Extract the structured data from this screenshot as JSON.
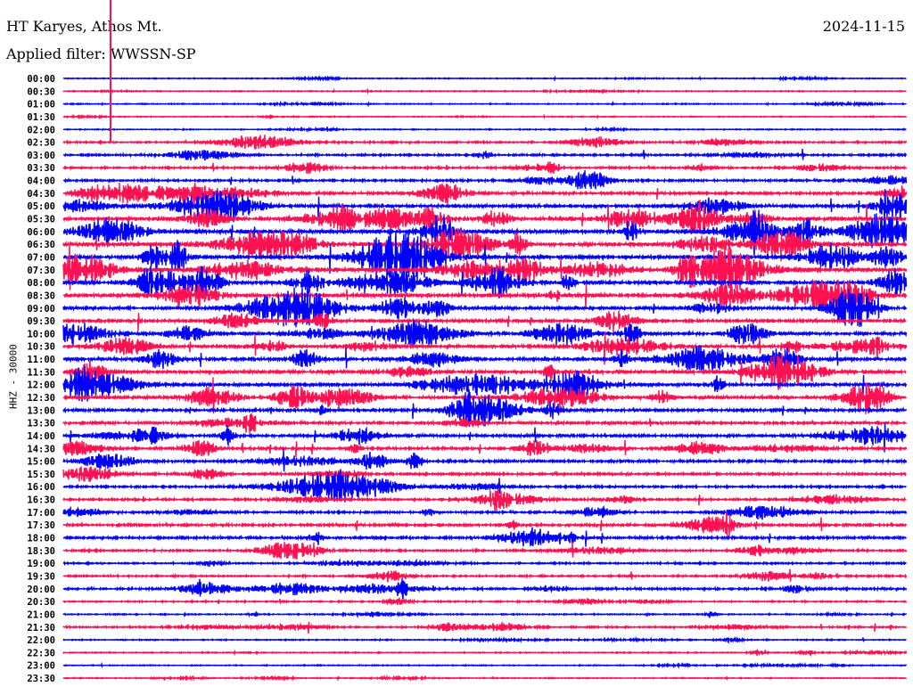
{
  "header": {
    "station": "HT Karyes, Athos Mt.",
    "filter": "Applied filter: WWSSN-SP",
    "date": "2024-11-15"
  },
  "chart_data": {
    "type": "line",
    "title": "HT Karyes, Athos Mt.",
    "ylabel": "HHZ - 30000",
    "colors": [
      "#0000ff",
      "#ff1050"
    ],
    "row_labels": [
      "00:00",
      "00:30",
      "01:00",
      "01:30",
      "02:00",
      "02:30",
      "03:00",
      "03:30",
      "04:00",
      "04:30",
      "05:00",
      "05:30",
      "06:00",
      "06:30",
      "07:00",
      "07:30",
      "08:00",
      "08:30",
      "09:00",
      "09:30",
      "10:00",
      "10:30",
      "11:00",
      "11:30",
      "12:00",
      "12:30",
      "13:00",
      "13:30",
      "14:00",
      "14:30",
      "15:00",
      "15:30",
      "16:00",
      "16:30",
      "17:00",
      "17:30",
      "18:00",
      "18:30",
      "19:00",
      "19:30",
      "20:00",
      "20:30",
      "21:00",
      "21:30",
      "22:00",
      "22:30",
      "23:00",
      "23:30"
    ],
    "relative_amplitude": [
      0.08,
      0.1,
      0.12,
      0.08,
      0.12,
      0.35,
      0.4,
      0.4,
      0.45,
      0.6,
      0.75,
      0.9,
      1.0,
      1.0,
      1.0,
      1.0,
      1.0,
      0.9,
      0.8,
      0.75,
      0.8,
      0.75,
      0.8,
      0.8,
      0.75,
      0.7,
      0.65,
      0.6,
      0.6,
      0.55,
      0.55,
      0.5,
      0.45,
      0.45,
      0.45,
      0.55,
      0.55,
      0.4,
      0.35,
      0.35,
      0.45,
      0.25,
      0.2,
      0.3,
      0.15,
      0.15,
      0.12,
      0.12
    ]
  }
}
